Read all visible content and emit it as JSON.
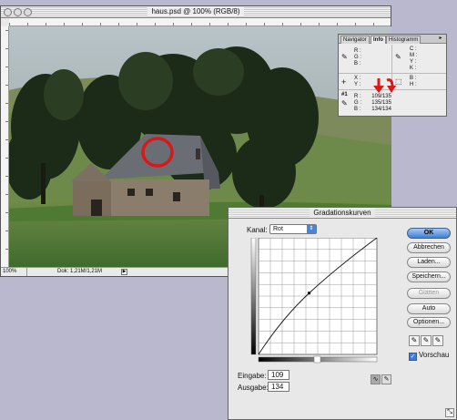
{
  "document": {
    "title": "haus.psd @ 100% (RGB/8)",
    "zoom": "100%",
    "doc_size": "Dok: 1,21M/1,21M",
    "menu_arrow": "▶"
  },
  "info_palette": {
    "tabs": [
      "Navigator",
      "Info",
      "Histogramm"
    ],
    "active_tab": "Info",
    "menu_glyph": "▸",
    "rgb_labels": "R :\nG :\nB :",
    "cmyk_labels": "C :\nM :\nY :\nK :",
    "xy_labels": "X :\nY :",
    "wh_labels": "B :\nH :",
    "sample_id": "#1",
    "sample_labels": "R :\nG :\nB :",
    "sample_values": "109/135\n135/135\n134/134"
  },
  "curves_dialog": {
    "title": "Gradationskurven",
    "channel_label": "Kanal:",
    "channel_value": "Rot",
    "input_label": "Eingabe:",
    "input_value": "109",
    "output_label": "Ausgabe:",
    "output_value": "134",
    "buttons": {
      "ok": "OK",
      "cancel": "Abbrechen",
      "load": "Laden...",
      "save": "Speichern...",
      "smooth": "Glätten",
      "auto": "Auto",
      "options": "Optionen..."
    },
    "preview_label": "Vorschau",
    "preview_checked": true,
    "curve_point": {
      "input": 109,
      "output": 134
    },
    "accent_color": "#3d7fd8"
  }
}
